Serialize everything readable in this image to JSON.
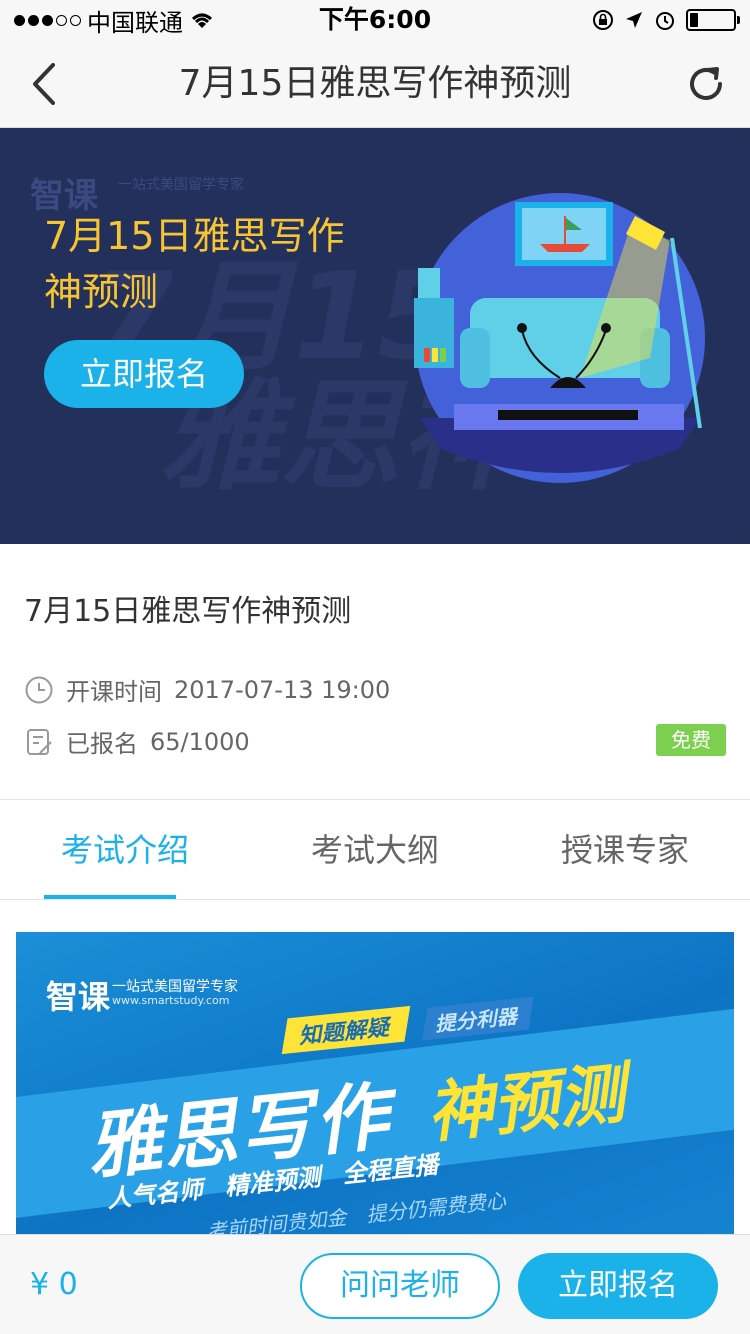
{
  "status_bar": {
    "carrier": "中国联通",
    "time": "下午6:00",
    "battery_level": 0.2
  },
  "nav": {
    "title": "7月15日雅思写作神预测",
    "back_icon": "chevron-left-icon",
    "refresh_icon": "refresh-icon"
  },
  "hero": {
    "logo": "智课",
    "logo_sub": "一站式美国留学专家",
    "title": "7月15日雅思写作神预测",
    "cta_label": "立即报名"
  },
  "course": {
    "title": "7月15日雅思写作神预测",
    "start_label": "开课时间",
    "start_time": "2017-07-13 19:00",
    "enroll_label": "已报名",
    "enroll_count": "65/1000",
    "price_badge": "免费"
  },
  "tabs": [
    {
      "label": "考试介绍",
      "active": true
    },
    {
      "label": "考试大纲",
      "active": false
    },
    {
      "label": "授课专家",
      "active": false
    }
  ],
  "poster": {
    "logo": "智课",
    "logo_sub": "一站式美国留学专家",
    "logo_url": "www.smartstudy.com",
    "tag1": "知题解疑",
    "tag2": "提分利器",
    "main_text": "雅思写作",
    "highlight": "神预测",
    "sub_text": "人气名师 精准预测 全程直播",
    "note": "考前时间贵如金 提分仍需费费心"
  },
  "bottom": {
    "price": "¥ 0",
    "ask_label": "问问老师",
    "enroll_label": "立即报名"
  },
  "colors": {
    "accent": "#1ab2e8",
    "hero_bg": "#24305c",
    "hero_title": "#f7c531",
    "free_badge": "#7dd04f"
  }
}
